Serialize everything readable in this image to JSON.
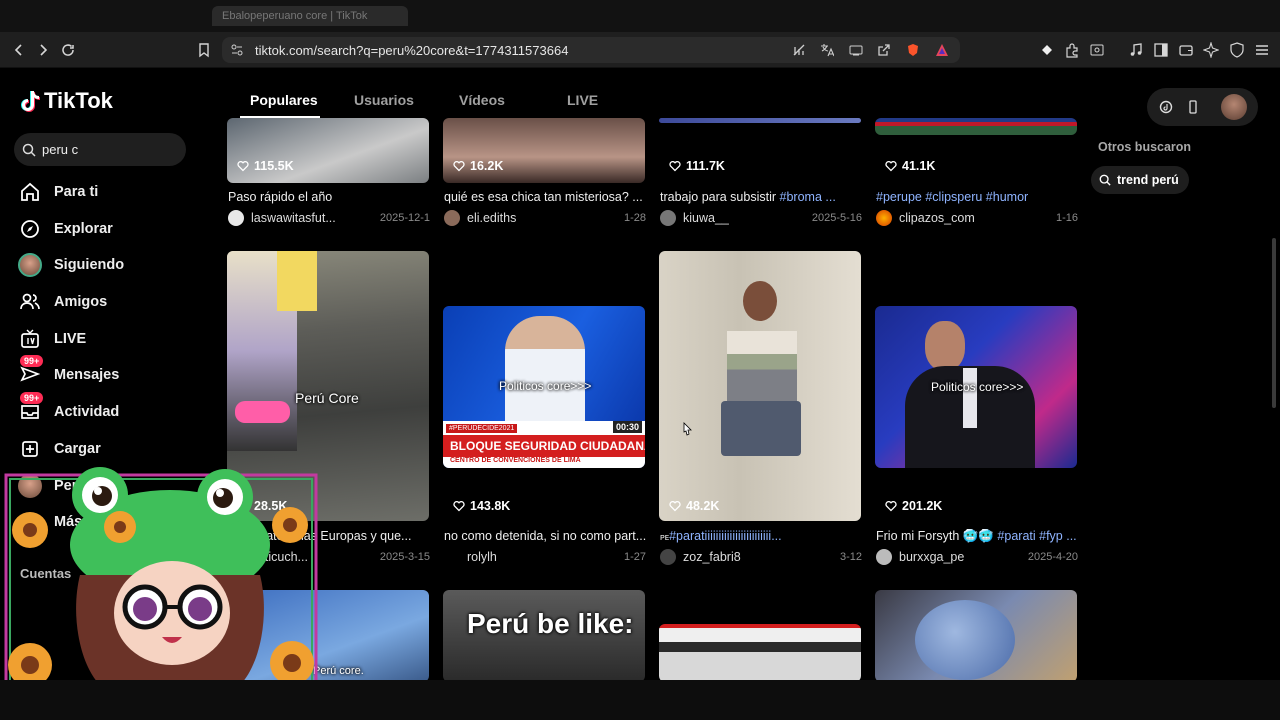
{
  "browser": {
    "tab_title": "Ebalopeperuano core | TikTok",
    "url": "tiktok.com/search?q=peru%20core&t=1774311573664"
  },
  "sidebar": {
    "logo": "TikTok",
    "search_value": "peru c",
    "nav": [
      {
        "label": "Para ti",
        "icon": "home-icon"
      },
      {
        "label": "Explorar",
        "icon": "compass-icon"
      },
      {
        "label": "Siguiendo",
        "icon": "avatar-icon"
      },
      {
        "label": "Amigos",
        "icon": "friends-icon"
      },
      {
        "label": "LIVE",
        "icon": "live-icon"
      },
      {
        "label": "Mensajes",
        "icon": "message-icon",
        "badge": "99+"
      },
      {
        "label": "Actividad",
        "icon": "inbox-icon",
        "badge": "99+"
      },
      {
        "label": "Cargar",
        "icon": "upload-icon"
      },
      {
        "label": "Perfil",
        "icon": "profile-icon"
      },
      {
        "label": "Más",
        "icon": "more-icon"
      }
    ],
    "cuentas_label": "Cuentas"
  },
  "tabs": [
    "Populares",
    "Usuarios",
    "Vídeos",
    "LIVE"
  ],
  "right_panel": {
    "otros_label": "Otros buscaron",
    "chip": "trend perú"
  },
  "rows": [
    [
      {
        "likes": "115.5K",
        "caption": "Paso rápido el año",
        "user": "laswawitasfut...",
        "date": "2025-12-1"
      },
      {
        "likes": "16.2K",
        "caption": "quié es esa chica tan misteriosa? ...",
        "user": "eli.ediths",
        "date": "1-28"
      },
      {
        "likes": "111.7K",
        "caption_plain": "trabajo para subsistir ",
        "caption_hash": "#broma ...",
        "user": "kiuwa__",
        "date": "2025-5-16"
      },
      {
        "likes": "41.1K",
        "caption_hash": "#perupe #clipsperu #humor",
        "user": "clipazos_com",
        "date": "1-16"
      }
    ],
    [
      {
        "likes": "28.5K",
        "caption": "Imagínate ... las Europas y que...",
        "user": "anticuch...",
        "date": "2025-3-15",
        "overlay": "Perú Core"
      },
      {
        "likes": "143.8K",
        "caption": "no como detenida, si no como part...",
        "user": "rolylh",
        "date": "1-27",
        "overlay": "Politicos core>>>",
        "banner": "BLOQUE SEGURIDAD CIUDADANA",
        "banner_sub": "CENTRO DE CONVENCIONES DE LIMA",
        "tag": "#PERÚDECIDE2021",
        "time": "00:30"
      },
      {
        "likes": "48.2K",
        "caption_prefix": "ᴘᴇ",
        "caption_hash": "#paratiiiiiiiiiiiiiiiiiiiiiiii...",
        "user": "zoz_fabri8",
        "date": "3-12"
      },
      {
        "likes": "201.2K",
        "caption_plain": "Frio mi Forsyth 🥶🥶 ",
        "caption_hash": "#parati #fyp ...",
        "user": "burxxga_pe",
        "date": "2025-4-20",
        "overlay": "Politicos core>>>"
      }
    ],
    [
      {
        "overlay": "Perú core."
      },
      {
        "overlay": "Perú be like:"
      },
      {},
      {}
    ]
  ],
  "colors": {
    "accent": "#fe2c55",
    "hashtag": "#8fb4ff"
  }
}
